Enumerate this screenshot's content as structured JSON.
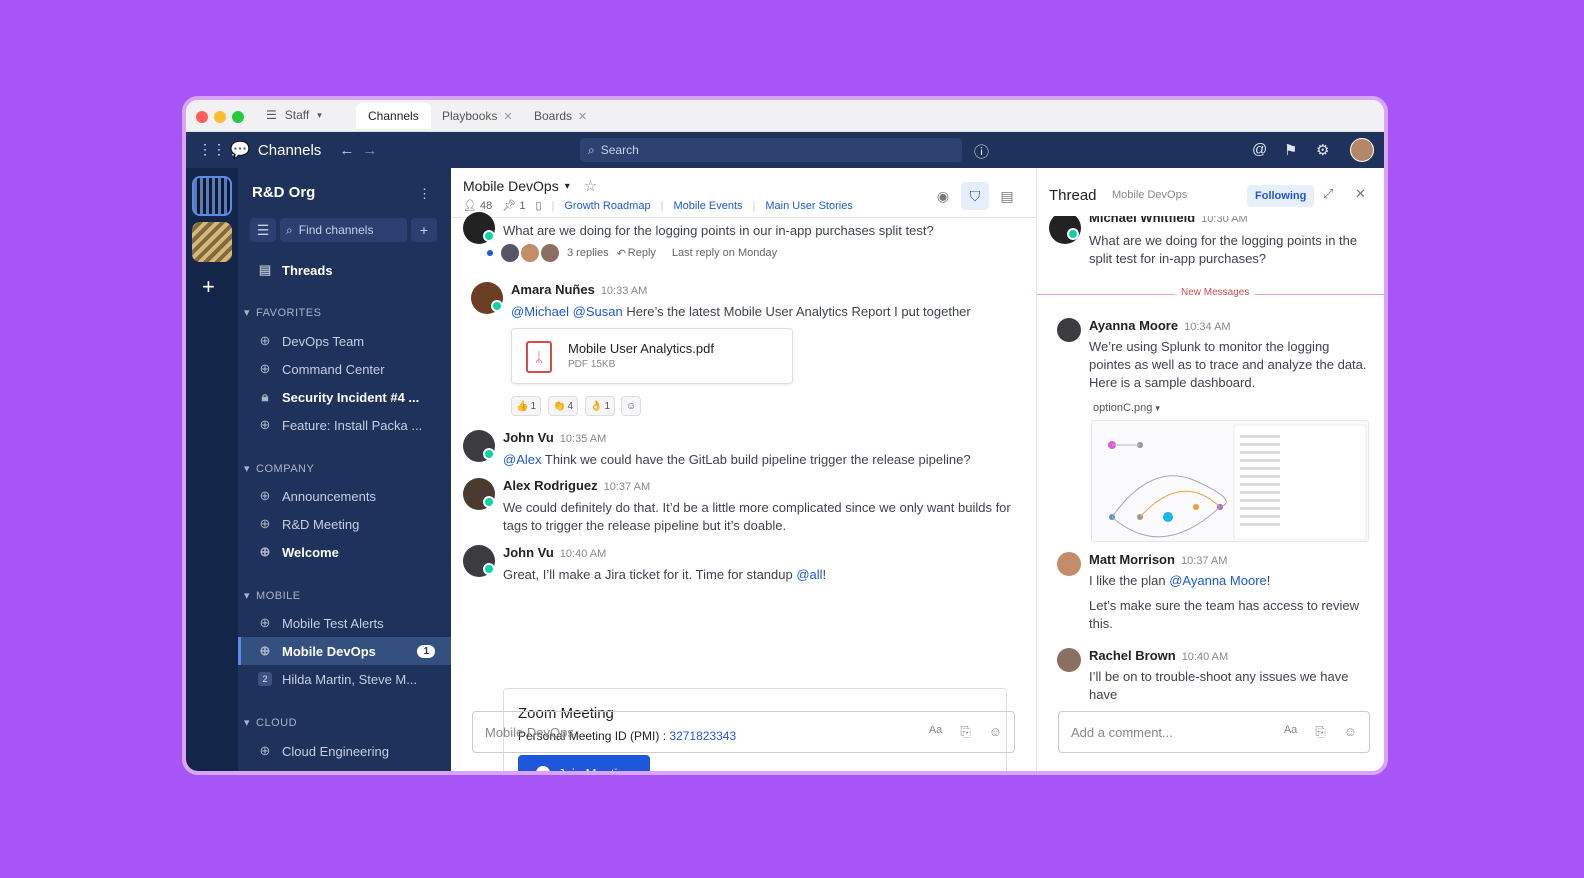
{
  "titlebar": {
    "workspace": "Staff",
    "tabs": [
      {
        "label": "Channels",
        "active": true
      },
      {
        "label": "Playbooks",
        "active": false
      },
      {
        "label": "Boards",
        "active": false
      }
    ]
  },
  "topnav": {
    "product": "Channels",
    "search_placeholder": "Search"
  },
  "sidebar": {
    "team_name": "R&D Org",
    "find_placeholder": "Find channels",
    "threads_label": "Threads",
    "categories": {
      "favorites": "FAVORITES",
      "company": "COMPANY",
      "mobile": "MOBILE",
      "cloud": "CLOUD"
    },
    "favorites": [
      "DevOps Team",
      "Command Center",
      "Security Incident #4 ...",
      "Feature: Install Packa ..."
    ],
    "company": [
      "Announcements",
      "R&D Meeting",
      "Welcome"
    ],
    "mobile": [
      "Mobile Test Alerts",
      "Mobile DevOps",
      "Hilda Martin, Steve M..."
    ],
    "cloud": [
      "Cloud Engineering"
    ],
    "mobile_devops_unread": "1",
    "dm_group_count": "2"
  },
  "channel": {
    "name": "Mobile DevOps",
    "members": "48",
    "pinned": "1",
    "bookmarks": [
      "Growth Roadmap",
      "Mobile Events",
      "Main User Stories"
    ],
    "composer_placeholder": "Mobile DevOps...",
    "format_label": "Aa"
  },
  "messages": {
    "m0_text": "What are we doing for the logging points in our in-app purchases split test?",
    "m0_replies": "3 replies",
    "m0_reply": "Reply",
    "m0_last": "Last reply on Monday",
    "m1_author": "Amara Nuñes",
    "m1_time": "10:33 AM",
    "m1_mention1": "@Michael",
    "m1_mention2": "@Susan",
    "m1_text": "Here’s the latest Mobile User Analytics Report I put together",
    "m1_file_name": "Mobile User Analytics.pdf",
    "m1_file_meta": "PDF 15KB",
    "m1_reactions": [
      {
        "emoji": "👍",
        "count": "1"
      },
      {
        "emoji": "👏",
        "count": "4"
      },
      {
        "emoji": "👌",
        "count": "1"
      }
    ],
    "m2_author": "John Vu",
    "m2_time": "10:35 AM",
    "m2_mention": "@Alex",
    "m2_text": "Think we could have the GitLab build pipeline trigger the release pipeline?",
    "m3_author": "Alex Rodriguez",
    "m3_time": "10:37 AM",
    "m3_text": "We could definitely do that. It’d be a little more complicated since we only want builds for tags to trigger the release pipeline but it’s doable.",
    "m4_author": "John Vu",
    "m4_time": "10:40 AM",
    "m4_text": "Great, I’ll make a Jira ticket for it. Time for standup",
    "m4_mention": "@all",
    "m4_end": "!",
    "zoom_title": "Zoom Meeting",
    "zoom_pmi_label": "Personal Meeting ID (PMI) :",
    "zoom_pmi": "3271823343",
    "zoom_join": "Join Meeting"
  },
  "thread": {
    "title": "Thread",
    "channel": "Mobile DevOps",
    "following": "Following",
    "root_author": "Michael Whitfield",
    "root_time": "10:30 AM",
    "root_text": "What are we doing for the logging points in the split test for in-app purchases?",
    "new_messages": "New Messages",
    "r1_author": "Ayanna Moore",
    "r1_time": "10:34 AM",
    "r1_text": "We’re using Splunk to monitor the logging pointes as well as to trace and analyze the data. Here is a sample dashboard.",
    "r1_file": "optionC.png",
    "r2_author": "Matt Morrison",
    "r2_time": "10:37 AM",
    "r2_text": "I like the plan",
    "r2_mention": "@Ayanna Moore",
    "r2_end": "!",
    "r2_text2": "Let’s make sure the team has access to review this.",
    "r3_author": "Rachel Brown",
    "r3_time": "10:40 AM",
    "r3_text": "I’ll be on to trouble-shoot any issues we have have",
    "composer_placeholder": "Add a comment...",
    "format_label": "Aa"
  },
  "colors": {
    "background": "#a855f7",
    "sidebar": "#1e325c",
    "accent": "#1c58d9",
    "online": "#06d6a0",
    "new_messages": "#d24b4e"
  }
}
